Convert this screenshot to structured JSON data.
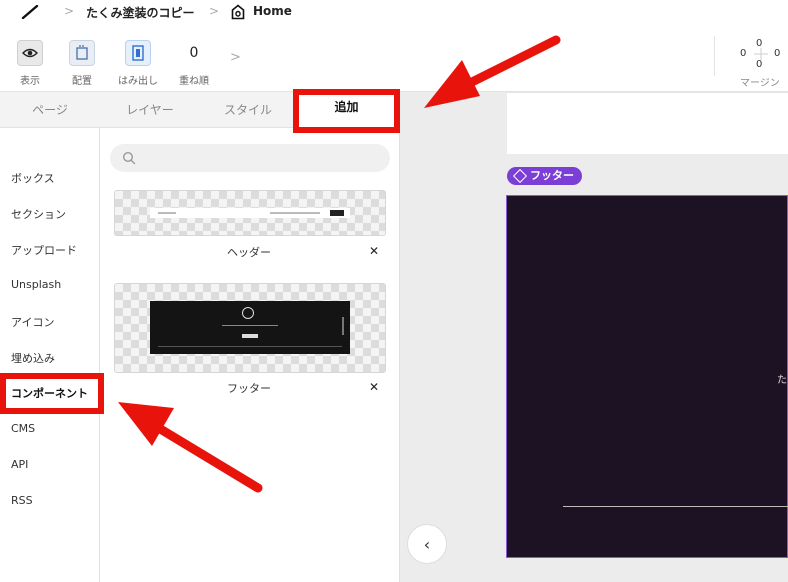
{
  "breadcrumb": {
    "project": "たくみ塗装のコピー",
    "page": "Home",
    "separator": ">"
  },
  "toolbar": {
    "view_label": "表示",
    "place_label": "配置",
    "overflow_label": "はみ出し",
    "zorder_label": "重ね順",
    "zorder_value": "0",
    "more": ">",
    "margin": {
      "top": "0",
      "left": "0",
      "right": "0",
      "bottom": "0",
      "label": "マージン"
    }
  },
  "panel": {
    "tabs": [
      {
        "label": "ページ"
      },
      {
        "label": "レイヤー"
      },
      {
        "label": "スタイル"
      },
      {
        "label": "追加"
      }
    ],
    "active_tab": "追加",
    "categories": [
      {
        "label": "ボックス"
      },
      {
        "label": "セクション"
      },
      {
        "label": "アップロード"
      },
      {
        "label": "Unsplash"
      },
      {
        "label": "アイコン"
      },
      {
        "label": "埋め込み"
      },
      {
        "label": "コンポーネント"
      },
      {
        "label": "CMS"
      },
      {
        "label": "API"
      },
      {
        "label": "RSS"
      }
    ],
    "active_category": "コンポーネント",
    "search_placeholder": "",
    "components": [
      {
        "name": "ヘッダー",
        "close": "✕"
      },
      {
        "name": "フッター",
        "close": "✕"
      }
    ]
  },
  "canvas": {
    "selected_badge": "フッター",
    "footer_text": "た",
    "collapse": "‹"
  },
  "colors": {
    "annotation_red": "#e8140c",
    "badge_purple": "#7b3fd6",
    "footer_bg": "#1d1124"
  }
}
